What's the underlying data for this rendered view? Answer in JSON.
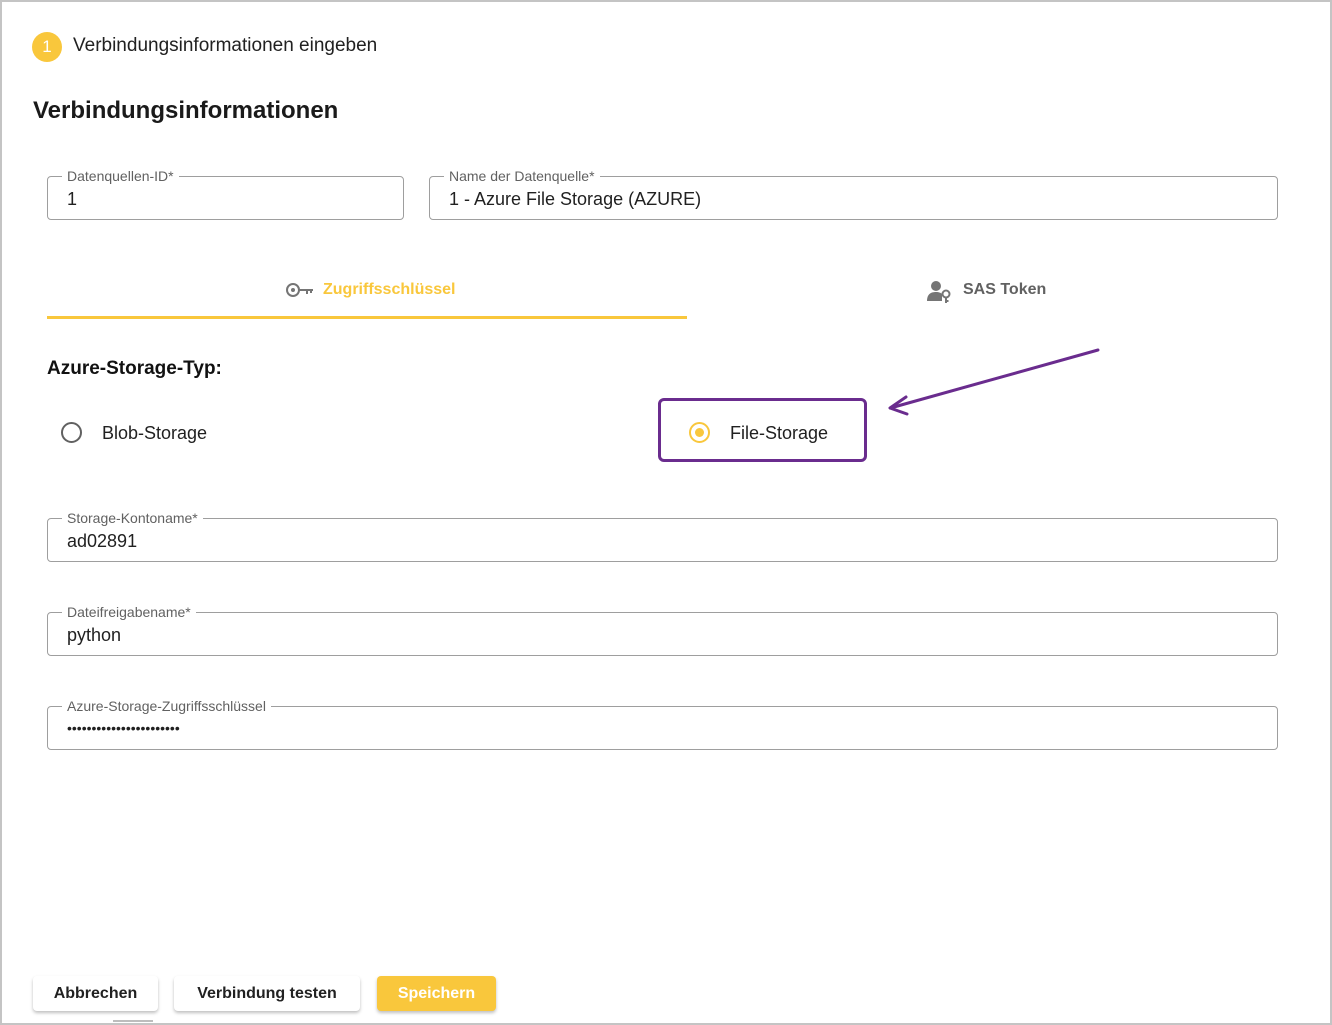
{
  "stepper": {
    "number": "1",
    "title": "Verbindungsinformationen eingeben"
  },
  "section_title": "Verbindungsinformationen",
  "fields": {
    "datasource_id": {
      "label": "Datenquellen-ID*",
      "value": "1"
    },
    "datasource_name": {
      "label": "Name der Datenquelle*",
      "value": "1 - Azure File Storage (AZURE)"
    },
    "account_name": {
      "label": "Storage-Kontoname*",
      "value": "ad02891"
    },
    "share_name": {
      "label": "Dateifreigabename*",
      "value": "python"
    },
    "access_key": {
      "label": "Azure-Storage-Zugriffsschlüssel",
      "value": "•••••••••••••••••••••••"
    }
  },
  "tabs": [
    {
      "label": "Zugriffsschlüssel",
      "icon": "key-icon",
      "active": true
    },
    {
      "label": "SAS Token",
      "icon": "user-key-icon",
      "active": false
    }
  ],
  "storage_type": {
    "heading": "Azure-Storage-Typ:",
    "options": [
      {
        "label": "Blob-Storage",
        "selected": false
      },
      {
        "label": "File-Storage",
        "selected": true
      }
    ]
  },
  "buttons": {
    "cancel": "Abbrechen",
    "test": "Verbindung testen",
    "save": "Speichern"
  },
  "colors": {
    "accent": "#f9c73c",
    "annotation": "#6a2c8e",
    "text": "#212121",
    "border": "#9e9e9e"
  }
}
